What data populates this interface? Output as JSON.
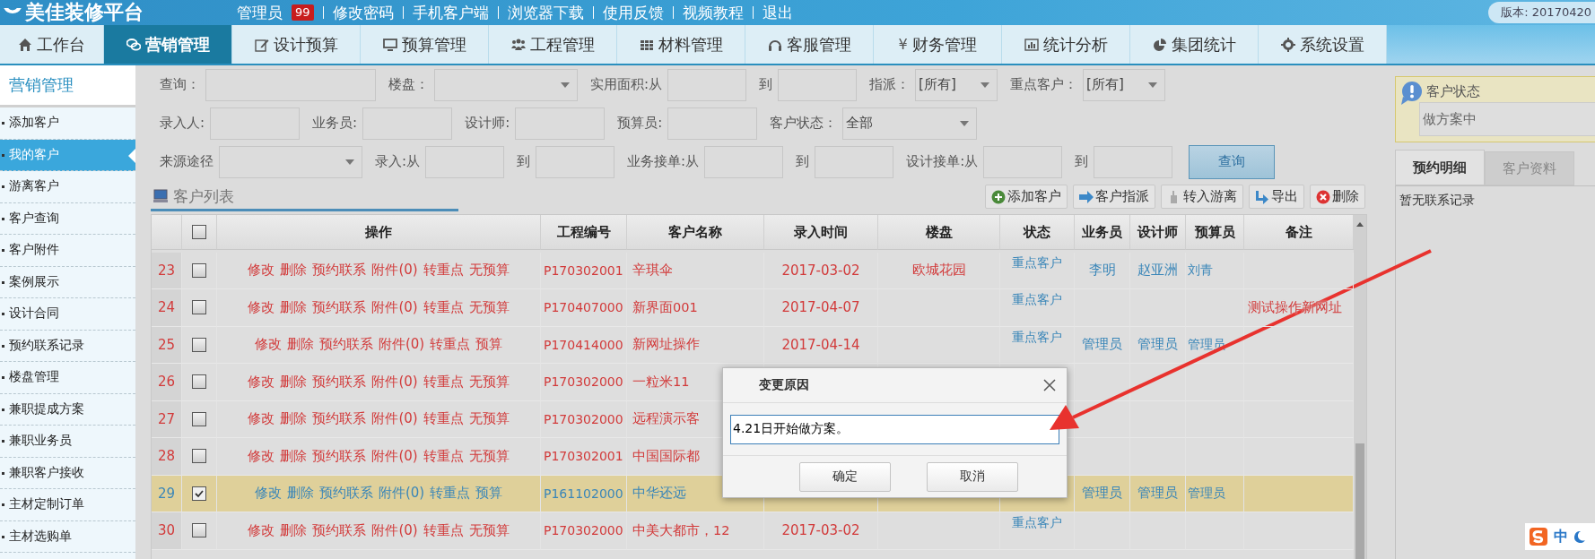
{
  "header": {
    "logo": "美佳装修平台",
    "user": "管理员",
    "badge": "99",
    "links": [
      "修改密码",
      "手机客户端",
      "浏览器下载",
      "使用反馈",
      "视频教程",
      "退出"
    ],
    "version": "版本: 20170420"
  },
  "tabs": [
    {
      "label": "工作台",
      "selected": false
    },
    {
      "label": "营销管理",
      "selected": true
    },
    {
      "label": "设计预算",
      "selected": false
    },
    {
      "label": "预算管理",
      "selected": false
    },
    {
      "label": "工程管理",
      "selected": false
    },
    {
      "label": "材料管理",
      "selected": false
    },
    {
      "label": "客服管理",
      "selected": false
    },
    {
      "label": "财务管理",
      "selected": false,
      "glyph": "¥"
    },
    {
      "label": "统计分析",
      "selected": false
    },
    {
      "label": "集团统计",
      "selected": false
    },
    {
      "label": "系统设置",
      "selected": false
    }
  ],
  "sidebar": {
    "title": "营销管理",
    "items": [
      {
        "label": "添加客户",
        "selected": false
      },
      {
        "label": "我的客户",
        "selected": true
      },
      {
        "label": "游离客户",
        "selected": false
      },
      {
        "label": "客户查询",
        "selected": false
      },
      {
        "label": "客户附件",
        "selected": false
      },
      {
        "label": "案例展示",
        "selected": false
      },
      {
        "label": "设计合同",
        "selected": false
      },
      {
        "label": "预约联系记录",
        "selected": false
      },
      {
        "label": "楼盘管理",
        "selected": false
      },
      {
        "label": "兼职提成方案",
        "selected": false
      },
      {
        "label": "兼职业务员",
        "selected": false
      },
      {
        "label": "兼职客户接收",
        "selected": false
      },
      {
        "label": "主材定制订单",
        "selected": false
      },
      {
        "label": "主材选购单",
        "selected": false
      }
    ]
  },
  "filters": [
    [
      {
        "label": "查询：",
        "kind": "input"
      },
      {
        "label": "楼盘：",
        "kind": "select"
      },
      {
        "label": "实用面积:从",
        "kind": "input"
      },
      {
        "label": "到",
        "kind": "input"
      },
      {
        "label": "指派：",
        "kind": "select",
        "value": "[所有]"
      },
      {
        "label": "重点客户：",
        "kind": "select",
        "value": "[所有]"
      }
    ],
    [
      {
        "label": "录入人:",
        "kind": "input"
      },
      {
        "label": "业务员:",
        "kind": "input"
      },
      {
        "label": "设计师:",
        "kind": "input"
      },
      {
        "label": "预算员:",
        "kind": "input"
      },
      {
        "label": "客户状态：",
        "kind": "select",
        "value": "全部"
      }
    ],
    [
      {
        "label": "来源途径",
        "kind": "select"
      },
      {
        "label": "录入:从",
        "kind": "input"
      },
      {
        "label": "到",
        "kind": "input"
      },
      {
        "label": "业务接单:从",
        "kind": "input"
      },
      {
        "label": "到",
        "kind": "input"
      },
      {
        "label": "设计接单:从",
        "kind": "input"
      },
      {
        "label": "到",
        "kind": "input"
      }
    ]
  ],
  "search_button": "查询",
  "list": {
    "title": "客户列表",
    "actions": [
      "添加客户",
      "客户指派",
      "转入游离",
      "导出",
      "删除"
    ]
  },
  "table": {
    "select_all": {
      "checked": false
    },
    "columns": [
      "操作",
      "工程编号",
      "客户名称",
      "录入时间",
      "楼盘",
      "状态",
      "业务员",
      "设计师",
      "预算员",
      "备注"
    ],
    "rows": [
      {
        "num": "23",
        "checked": false,
        "selected": false,
        "ops": [
          "修改",
          "删除",
          "预约联系",
          "附件(0)",
          "转重点",
          "无预算"
        ],
        "code": "P170302001",
        "name": "辛琪伞",
        "time": "2017-03-02",
        "building": "欧城花园",
        "status": "重点客户",
        "sales": "李明",
        "designer": "赵亚洲",
        "budget": "刘青"
      },
      {
        "num": "24",
        "checked": false,
        "selected": false,
        "ops": [
          "修改",
          "删除",
          "预约联系",
          "附件(0)",
          "转重点",
          "无预算"
        ],
        "code": "P170407000",
        "name": "新界面001",
        "time": "2017-04-07",
        "status": "重点客户",
        "note": "测试操作新网址"
      },
      {
        "num": "25",
        "checked": false,
        "selected": false,
        "ops": [
          "修改",
          "删除",
          "预约联系",
          "附件(0)",
          "转重点",
          "预算"
        ],
        "code": "P170414000",
        "name": "新网址操作",
        "time": "2017-04-14",
        "status": "重点客户",
        "sales": "管理员",
        "designer": "管理员",
        "budget": "管理员"
      },
      {
        "num": "26",
        "checked": false,
        "selected": false,
        "ops": [
          "修改",
          "删除",
          "预约联系",
          "附件(0)",
          "转重点",
          "无预算"
        ],
        "code": "P170302000",
        "name": "一粒米11"
      },
      {
        "num": "27",
        "checked": false,
        "selected": false,
        "ops": [
          "修改",
          "删除",
          "预约联系",
          "附件(0)",
          "转重点",
          "无预算"
        ],
        "code": "P170302000",
        "name": "远程演示客"
      },
      {
        "num": "28",
        "checked": false,
        "selected": false,
        "ops": [
          "修改",
          "删除",
          "预约联系",
          "附件(0)",
          "转重点",
          "无预算"
        ],
        "code": "P170302001",
        "name": "中国国际都"
      },
      {
        "num": "29",
        "checked": true,
        "selected": true,
        "ops": [
          "修改",
          "删除",
          "预约联系",
          "附件(0)",
          "转重点",
          "预算"
        ],
        "code": "P161102000",
        "name": "中华还远",
        "sales": "管理员",
        "designer": "管理员",
        "budget": "管理员"
      },
      {
        "num": "30",
        "checked": false,
        "selected": false,
        "ops": [
          "修改",
          "删除",
          "预约联系",
          "附件(0)",
          "转重点",
          "无预算"
        ],
        "code": "P170302000",
        "name": "中美大都市，12",
        "time": "2017-03-02",
        "status": "重点客户"
      }
    ]
  },
  "status_card": {
    "title": "客户状态",
    "value": "做方案中"
  },
  "detail_tabs": [
    {
      "label": "预约明细",
      "selected": true
    },
    {
      "label": "客户资料",
      "selected": false
    }
  ],
  "detail_empty": "暂无联系记录",
  "dialog": {
    "title": "变更原因",
    "value": "4.21日开始做方案。",
    "buttons": [
      "确定",
      "取消"
    ]
  },
  "ime": {
    "label": "中"
  }
}
